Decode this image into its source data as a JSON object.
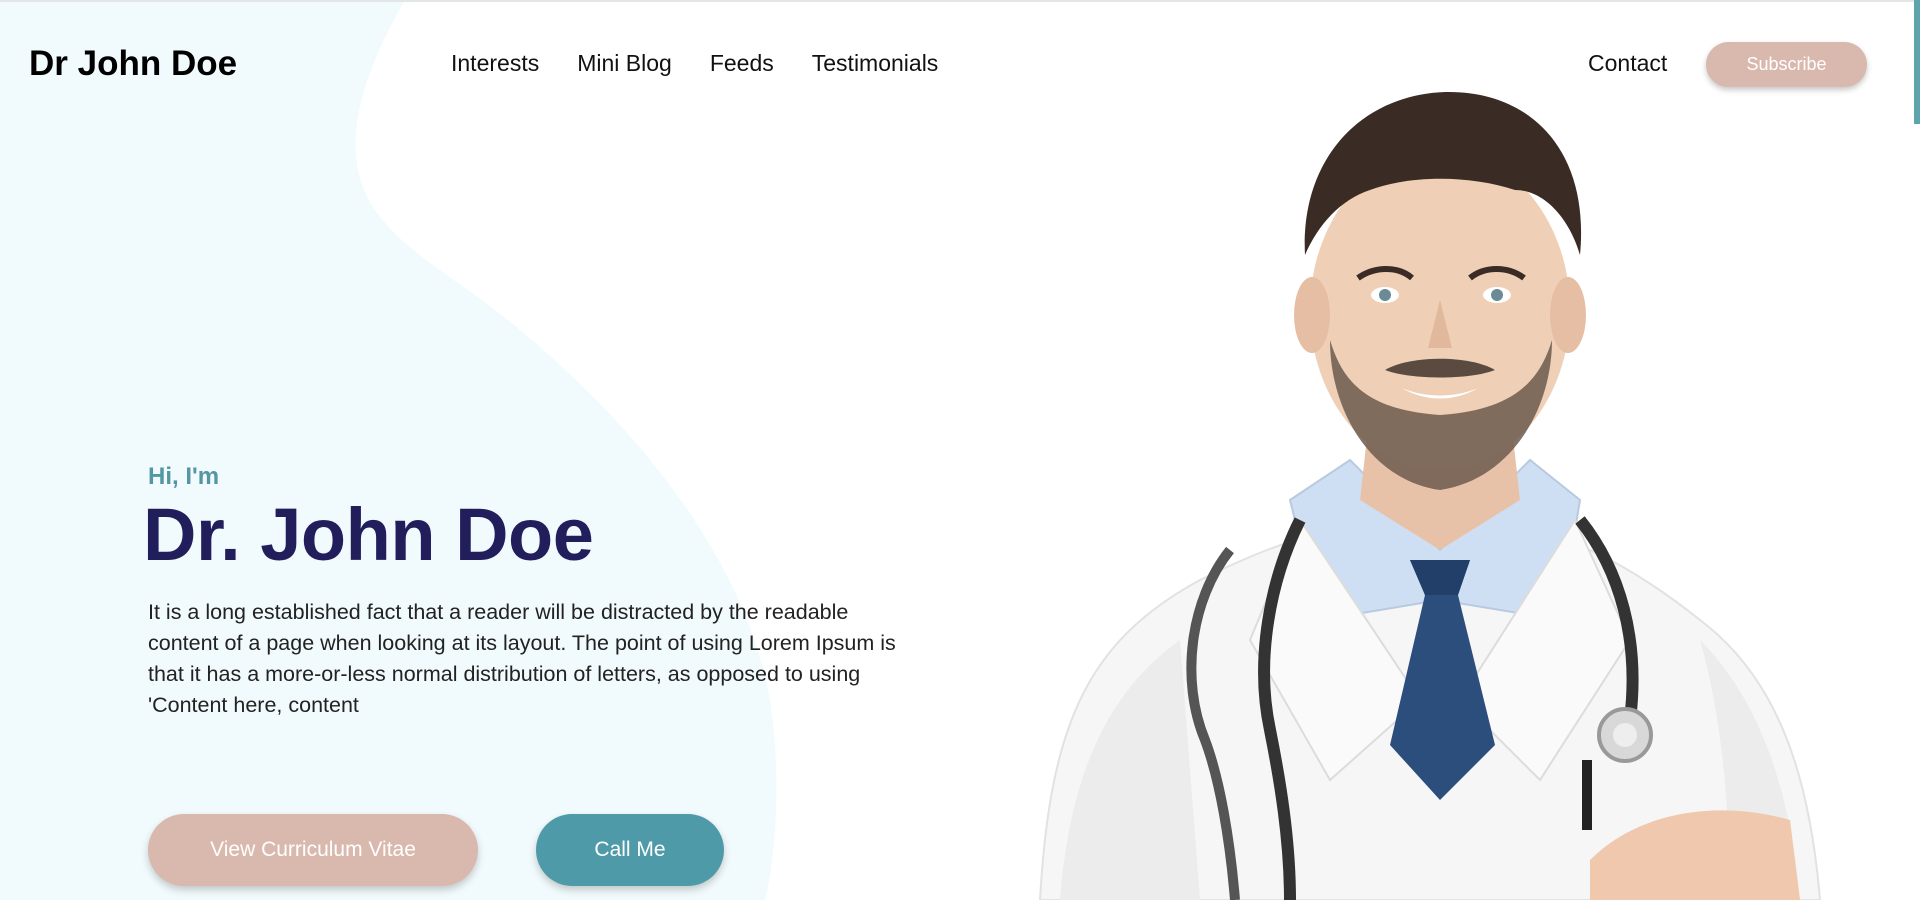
{
  "header": {
    "brand": "Dr John Doe",
    "nav": [
      "Interests",
      "Mini Blog",
      "Feeds",
      "Testimonials"
    ],
    "contact": "Contact",
    "subscribe": "Subscribe"
  },
  "hero": {
    "greeting": "Hi, I'm",
    "name": "Dr. John Doe",
    "description": "It is a long established fact that a reader will be distracted by the readable content of a page when looking at its layout. The point of using Lorem Ipsum is that it has a more-or-less normal distribution of letters, as opposed to using 'Content here, content",
    "cv_button": "View Curriculum Vitae",
    "call_button": "Call Me"
  },
  "colors": {
    "accent_teal": "#4f9aa9",
    "accent_pink": "#d9b8ad",
    "name_navy": "#221e5c",
    "blob": "#f1fafc"
  },
  "image": {
    "icon": "doctor-portrait"
  }
}
